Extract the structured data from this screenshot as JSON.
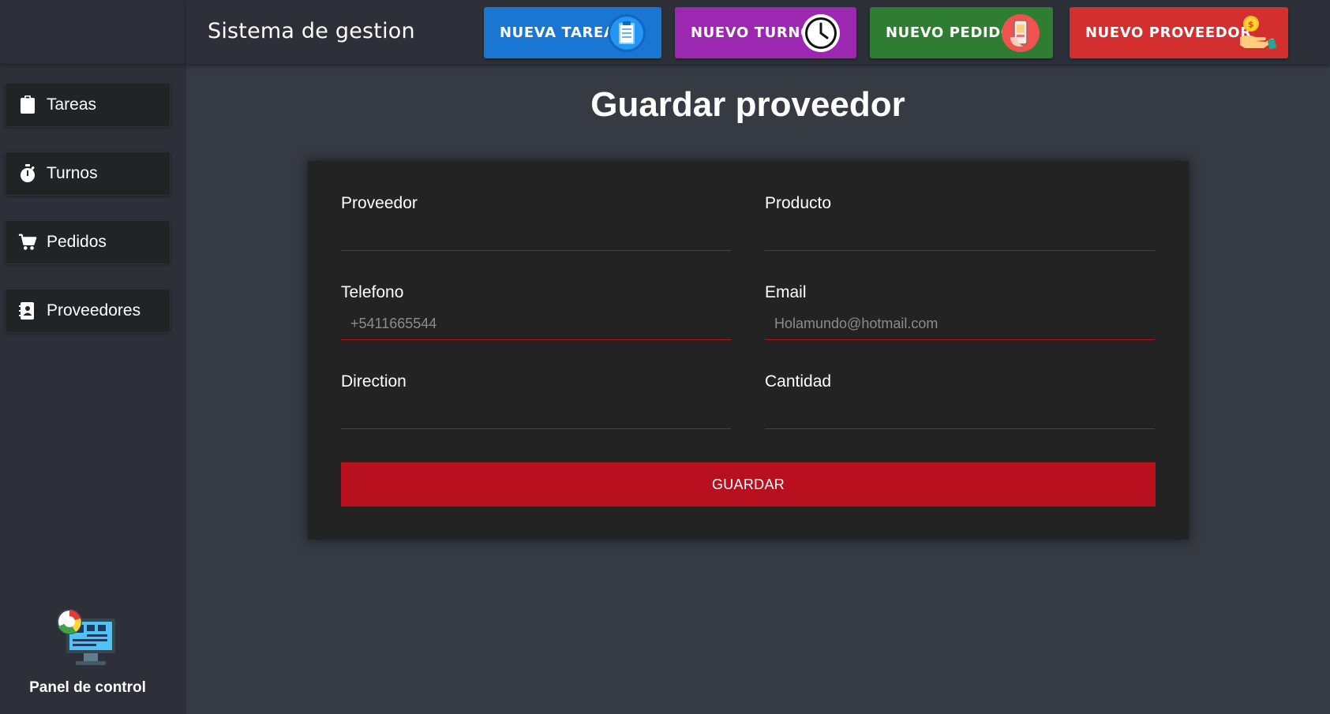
{
  "app": {
    "title": "Sistema de gestion"
  },
  "colors": {
    "nueva_tarea": "#1976d2",
    "nuevo_turno": "#9c27b0",
    "nuevo_pedido": "#2e7d32",
    "nuevo_proveedor": "#d32f2f",
    "accent": "#b8101f"
  },
  "toolbar": {
    "buttons": [
      {
        "label": "NUEVA TAREA",
        "icon": "clipboard-icon"
      },
      {
        "label": "NUEVO TURNO",
        "icon": "clock-icon"
      },
      {
        "label": "NUEVO PEDIDO",
        "icon": "phone-order-icon"
      },
      {
        "label": "NUEVO PROVEEDOR",
        "icon": "money-hand-icon"
      }
    ]
  },
  "sidebar": {
    "items": [
      {
        "label": "Tareas",
        "icon": "clipboard-icon"
      },
      {
        "label": "Turnos",
        "icon": "stopwatch-icon"
      },
      {
        "label": "Pedidos",
        "icon": "cart-icon"
      },
      {
        "label": "Proveedores",
        "icon": "contact-book-icon"
      }
    ],
    "panel_label": "Panel de control"
  },
  "main": {
    "title": "Guardar proveedor",
    "form": {
      "proveedor": {
        "label": "Proveedor",
        "value": "",
        "placeholder": ""
      },
      "producto": {
        "label": "Producto",
        "value": "",
        "placeholder": ""
      },
      "telefono": {
        "label": "Telefono",
        "value": "",
        "placeholder": "+5411665544"
      },
      "email": {
        "label": "Email",
        "value": "",
        "placeholder": "Holamundo@hotmail.com"
      },
      "direction": {
        "label": "Direction",
        "value": "",
        "placeholder": ""
      },
      "cantidad": {
        "label": "Cantidad",
        "value": "",
        "placeholder": ""
      },
      "submit_label": "GUARDAR"
    }
  }
}
